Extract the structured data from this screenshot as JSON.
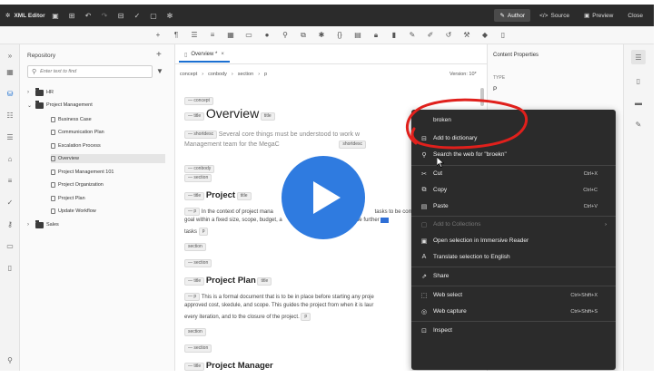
{
  "app": {
    "title": "XML Editor"
  },
  "modes": [
    {
      "label": "Author",
      "active": true
    },
    {
      "label": "Source",
      "active": false
    },
    {
      "label": "Preview",
      "active": false
    },
    {
      "label": "Close",
      "active": false
    }
  ],
  "repository": {
    "title": "Repository",
    "search_placeholder": "Enter text to find",
    "items": [
      {
        "label": "HR",
        "type": "folder",
        "level": 0,
        "expanded": false
      },
      {
        "label": "Project Management",
        "type": "folder",
        "level": 0,
        "expanded": true
      },
      {
        "label": "Business Case",
        "type": "file",
        "level": 1
      },
      {
        "label": "Communication Plan",
        "type": "file",
        "level": 1
      },
      {
        "label": "Escalation Process",
        "type": "file",
        "level": 1
      },
      {
        "label": "Overview",
        "type": "file",
        "level": 1,
        "selected": true
      },
      {
        "label": "Project Management 101",
        "type": "file",
        "level": 1
      },
      {
        "label": "Project Organization",
        "type": "file",
        "level": 1
      },
      {
        "label": "Project Plan",
        "type": "file",
        "level": 1
      },
      {
        "label": "Update Workflow",
        "type": "file",
        "level": 1
      },
      {
        "label": "Sales",
        "type": "folder",
        "level": 0,
        "expanded": false
      }
    ]
  },
  "editor": {
    "tab_label": "Overview *",
    "breadcrumbs": [
      "concept",
      "conbody",
      "section",
      "p"
    ],
    "version": "Version: 10*",
    "tags": {
      "concept": "concept",
      "title": "title",
      "shortdesc": "shortdesc",
      "conbody": "conbody",
      "section": "section",
      "p": "p"
    },
    "overview_title": "Overview",
    "shortdesc_line1": "Several core things must be understood to work w",
    "shortdesc_line2": "Management team for the MegaC",
    "project_heading": "Project",
    "project_line1": "In the context of project mana",
    "project_line1b": "tasks to be compl",
    "project_line2": "goal within a fixed size, scope, budget, a",
    "project_line2b": "nese may be further",
    "project_line3": "tasks",
    "project_plan_heading": "Project Plan",
    "plan_line1": "This is a formal document that is to be in place before starting any proje",
    "plan_line2": "approved cost, skedule, and scope. This guides the project from when it is laur",
    "plan_line3": "every iteration, and to the closure of the project.",
    "project_manager_heading": "Project Manager"
  },
  "properties": {
    "title": "Content Properties",
    "type_label": "TYPE",
    "type_value": "P"
  },
  "context_menu": {
    "items": [
      {
        "label": "broken",
        "shortcut": "",
        "icon": "none",
        "disabled": false
      },
      {
        "label": "Add to dictionary",
        "shortcut": "",
        "icon": "dictionary-icon",
        "disabled": false
      },
      {
        "label": "Search the web for \"broekn\"",
        "shortcut": "",
        "icon": "search-icon",
        "disabled": false
      },
      {
        "label": "Cut",
        "shortcut": "Ctrl+X",
        "icon": "cut-icon",
        "disabled": false
      },
      {
        "label": "Copy",
        "shortcut": "Ctrl+C",
        "icon": "copy-icon",
        "disabled": false
      },
      {
        "label": "Paste",
        "shortcut": "Ctrl+V",
        "icon": "paste-icon",
        "disabled": false
      },
      {
        "label": "Add to Collections",
        "shortcut": "",
        "icon": "collections-icon",
        "disabled": true
      },
      {
        "label": "Open selection in Immersive Reader",
        "shortcut": "",
        "icon": "reader-icon",
        "disabled": false
      },
      {
        "label": "Translate selection to English",
        "shortcut": "",
        "icon": "translate-icon",
        "disabled": false
      },
      {
        "label": "Share",
        "shortcut": "",
        "icon": "share-icon",
        "disabled": false
      },
      {
        "label": "Web select",
        "shortcut": "Ctrl+Shift+X",
        "icon": "web-select-icon",
        "disabled": false
      },
      {
        "label": "Web capture",
        "shortcut": "Ctrl+Shift+S",
        "icon": "web-capture-icon",
        "disabled": false
      },
      {
        "label": "Inspect",
        "shortcut": "",
        "icon": "inspect-icon",
        "disabled": false
      }
    ]
  },
  "colors": {
    "topbar": "#2b2b2b",
    "accent": "#1b6fd1",
    "play_button": "#2f7be0",
    "annotation": "#e0201c"
  }
}
